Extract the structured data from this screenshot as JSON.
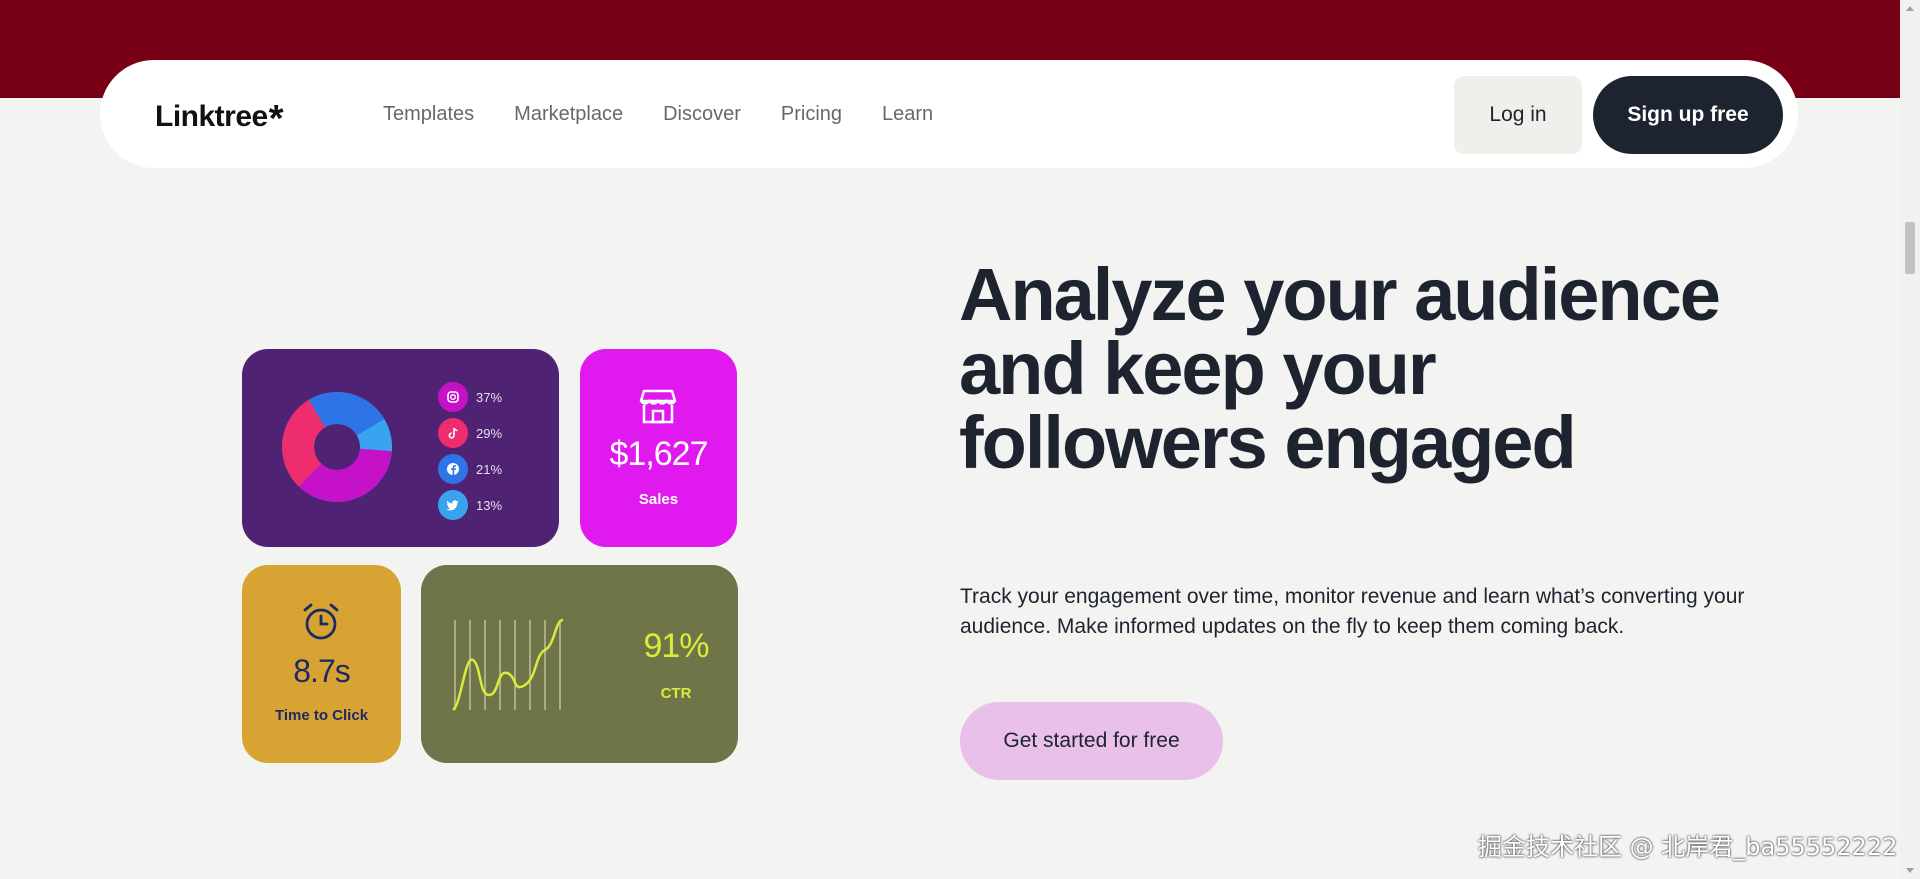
{
  "brand": {
    "name": "Linktree",
    "mark": "*",
    "color_band": "#780016",
    "dark": "#1e2330"
  },
  "nav": {
    "links": [
      "Templates",
      "Marketplace",
      "Discover",
      "Pricing",
      "Learn"
    ],
    "login_label": "Log in",
    "signup_label": "Sign up free"
  },
  "hero": {
    "headline": "Analyze your audience and keep your followers engaged",
    "subtext": "Track your engagement over time, monitor revenue and learn what’s converting your audience. Make informed updates on the fly to keep them coming back.",
    "cta_label": "Get started for free"
  },
  "cards": {
    "donut": {
      "legend": [
        {
          "icon": "instagram-icon",
          "value": "37%",
          "color": "#c512c8"
        },
        {
          "icon": "tiktok-icon",
          "value": "29%",
          "color": "#ee2d6e"
        },
        {
          "icon": "facebook-icon",
          "value": "21%",
          "color": "#2f74e6"
        },
        {
          "icon": "twitter-icon",
          "value": "13%",
          "color": "#3aa3f0"
        }
      ]
    },
    "sales": {
      "icon": "store-icon",
      "value": "$1,627",
      "label": "Sales"
    },
    "time": {
      "icon": "alarm-clock-icon",
      "value": "8.7s",
      "label": "Time to Click"
    },
    "ctr": {
      "value": "91%",
      "label": "CTR"
    }
  },
  "watermark": "掘金技术社区 @ 北岸君_ba55552222"
}
